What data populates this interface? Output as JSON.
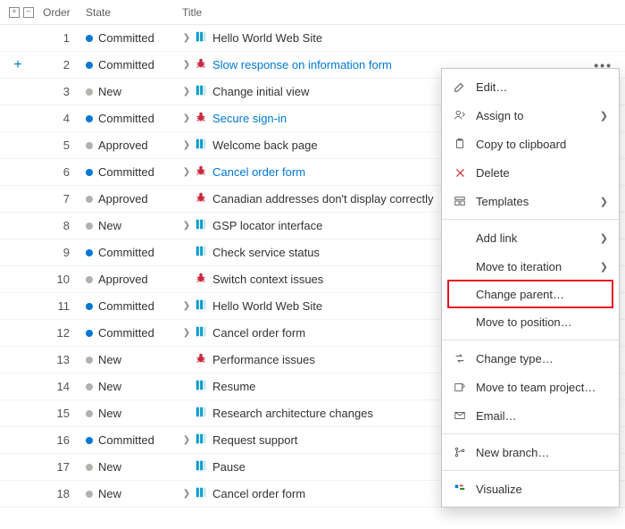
{
  "columns": {
    "order": "Order",
    "state": "State",
    "title": "Title"
  },
  "rows": [
    {
      "order": 1,
      "state": "Committed",
      "stateKind": "committed",
      "hasChevron": true,
      "iconKind": "pbi",
      "title": "Hello World Web Site",
      "selected": false,
      "dots": false
    },
    {
      "order": 2,
      "state": "Committed",
      "stateKind": "committed",
      "hasChevron": true,
      "iconKind": "bug",
      "title": "Slow response on information form",
      "selected": true,
      "dots": true,
      "showPlus": true
    },
    {
      "order": 3,
      "state": "New",
      "stateKind": "new",
      "hasChevron": true,
      "iconKind": "pbi",
      "title": "Change initial view",
      "selected": false,
      "dots": false
    },
    {
      "order": 4,
      "state": "Committed",
      "stateKind": "committed",
      "hasChevron": true,
      "iconKind": "bug",
      "title": "Secure sign-in",
      "selected": true,
      "dots": true
    },
    {
      "order": 5,
      "state": "Approved",
      "stateKind": "approved",
      "hasChevron": true,
      "iconKind": "pbi",
      "title": "Welcome back page",
      "selected": false,
      "dots": false
    },
    {
      "order": 6,
      "state": "Committed",
      "stateKind": "committed",
      "hasChevron": true,
      "iconKind": "bug",
      "title": "Cancel order form",
      "selected": true,
      "dots": true
    },
    {
      "order": 7,
      "state": "Approved",
      "stateKind": "approved",
      "hasChevron": false,
      "iconKind": "bug",
      "title": "Canadian addresses don't display correctly",
      "selected": false,
      "dots": false
    },
    {
      "order": 8,
      "state": "New",
      "stateKind": "new",
      "hasChevron": true,
      "iconKind": "pbi",
      "title": "GSP locator interface",
      "selected": false,
      "dots": false
    },
    {
      "order": 9,
      "state": "Committed",
      "stateKind": "committed",
      "hasChevron": false,
      "iconKind": "pbi",
      "title": "Check service status",
      "selected": false,
      "dots": false
    },
    {
      "order": 10,
      "state": "Approved",
      "stateKind": "approved",
      "hasChevron": false,
      "iconKind": "bug",
      "title": "Switch context issues",
      "selected": false,
      "dots": false
    },
    {
      "order": 11,
      "state": "Committed",
      "stateKind": "committed",
      "hasChevron": true,
      "iconKind": "pbi",
      "title": "Hello World Web Site",
      "selected": false,
      "dots": false
    },
    {
      "order": 12,
      "state": "Committed",
      "stateKind": "committed",
      "hasChevron": true,
      "iconKind": "pbi",
      "title": "Cancel order form",
      "selected": false,
      "dots": false
    },
    {
      "order": 13,
      "state": "New",
      "stateKind": "new",
      "hasChevron": false,
      "iconKind": "bug",
      "title": "Performance issues",
      "selected": false,
      "dots": false
    },
    {
      "order": 14,
      "state": "New",
      "stateKind": "new",
      "hasChevron": false,
      "iconKind": "pbi",
      "title": "Resume",
      "selected": false,
      "dots": false
    },
    {
      "order": 15,
      "state": "New",
      "stateKind": "new",
      "hasChevron": false,
      "iconKind": "pbi",
      "title": "Research architecture changes",
      "selected": false,
      "dots": false
    },
    {
      "order": 16,
      "state": "Committed",
      "stateKind": "committed",
      "hasChevron": true,
      "iconKind": "pbi",
      "title": "Request support",
      "selected": false,
      "dots": false
    },
    {
      "order": 17,
      "state": "New",
      "stateKind": "new",
      "hasChevron": false,
      "iconKind": "pbi",
      "title": "Pause",
      "selected": false,
      "dots": false
    },
    {
      "order": 18,
      "state": "New",
      "stateKind": "new",
      "hasChevron": true,
      "iconKind": "pbi",
      "title": "Cancel order form",
      "selected": false,
      "dots": false
    }
  ],
  "contextMenu": {
    "edit": "Edit…",
    "assignTo": "Assign to",
    "copy": "Copy to clipboard",
    "delete": "Delete",
    "templates": "Templates",
    "addLink": "Add link",
    "moveIter": "Move to iteration",
    "changeParent": "Change parent…",
    "movePos": "Move to position…",
    "changeType": "Change type…",
    "moveTeam": "Move to team project…",
    "email": "Email…",
    "newBranch": "New branch…",
    "visualize": "Visualize"
  }
}
